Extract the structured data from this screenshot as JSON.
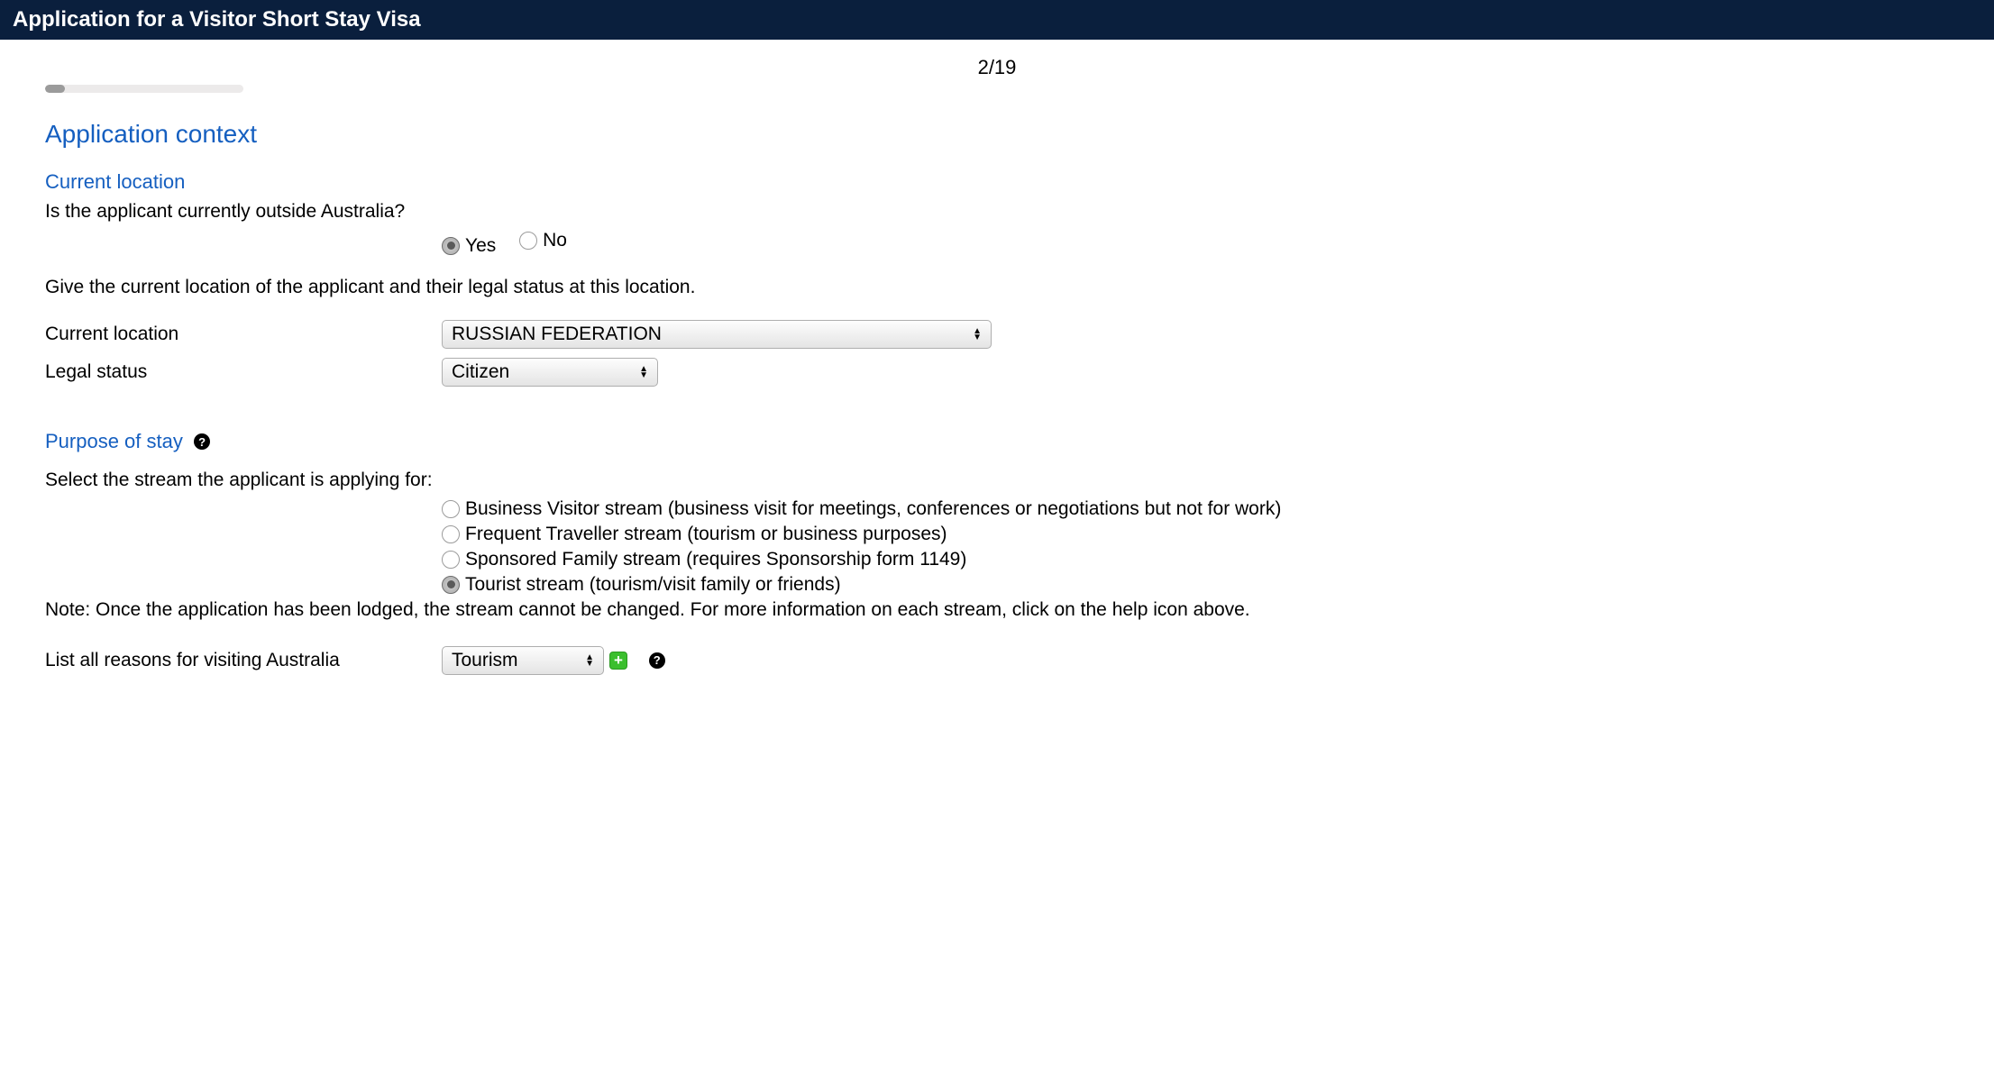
{
  "header": {
    "title": "Application for a Visitor Short Stay Visa"
  },
  "page_indicator": "2/19",
  "section": {
    "title": "Application context",
    "location_sub": "Current location",
    "q_outside": "Is the applicant currently outside Australia?",
    "yes": "Yes",
    "no": "No",
    "outside_selected": "Yes",
    "instr_location": "Give the current location of the applicant and their legal status at this location.",
    "loc_label": "Current location",
    "loc_value": "RUSSIAN FEDERATION",
    "legal_label": "Legal status",
    "legal_value": "Citizen",
    "purpose_sub": "Purpose of stay",
    "stream_prompt": "Select the stream the applicant is applying for:",
    "streams": [
      "Business Visitor stream (business visit for meetings, conferences or negotiations but not for work)",
      "Frequent Traveller stream (tourism or business purposes)",
      "Sponsored Family stream (requires Sponsorship form 1149)",
      "Tourist stream (tourism/visit family or friends)"
    ],
    "stream_selected_index": 3,
    "stream_note": "Note: Once the application has been lodged, the stream cannot be changed. For more information on each stream, click on the help icon above.",
    "reasons_label": "List all reasons for visiting Australia",
    "reasons_value": "Tourism"
  }
}
